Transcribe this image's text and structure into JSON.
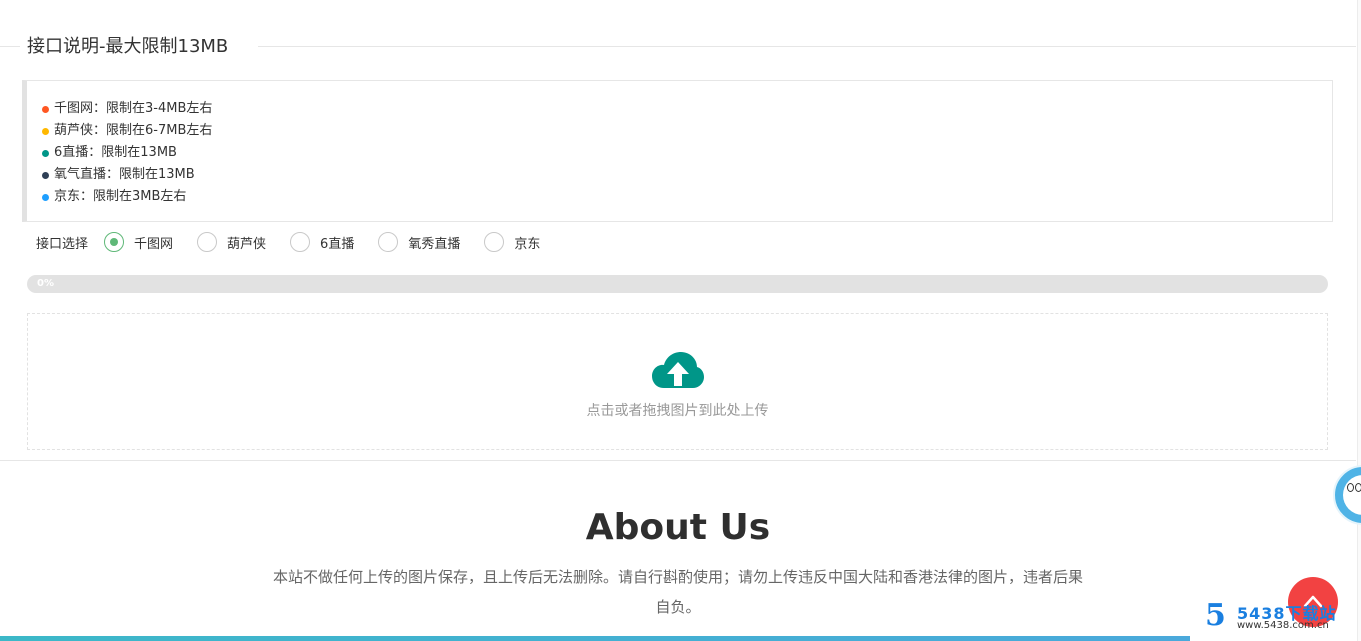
{
  "section": {
    "legend": "接口说明-最大限制13MB"
  },
  "notice": {
    "items": [
      {
        "label": "千图网：限制在3-4MB左右",
        "dot_color": "#ff5722"
      },
      {
        "label": "葫芦侠：限制在6-7MB左右",
        "dot_color": "#ffb800"
      },
      {
        "label": "6直播：限制在13MB",
        "dot_color": "#009688"
      },
      {
        "label": "氧气直播：限制在13MB",
        "dot_color": "#2f4056"
      },
      {
        "label": "京东：限制在3MB左右",
        "dot_color": "#1e9fff"
      }
    ]
  },
  "interface_select": {
    "label": "接口选择",
    "options": [
      "千图网",
      "葫芦侠",
      "6直播",
      "氧秀直播",
      "京东"
    ],
    "selected": "千图网"
  },
  "progress": {
    "value": 0,
    "text": "0%"
  },
  "upload": {
    "hint": "点击或者拖拽图片到此处上传",
    "icon": "cloud-upload-icon",
    "icon_color": "#009688"
  },
  "about": {
    "title": "About Us",
    "text": "本站不做任何上传的图片保存，且上传后无法删除。请自行斟酌使用；请勿上传违反中国大陆和香港法律的图片，违者后果自负。"
  },
  "back_to_top": {
    "icon": "chevron-up-icon",
    "color": "#f24242"
  },
  "watermark": {
    "logo": "5",
    "name": "5438下载站",
    "url": "www.5438.com.cn"
  },
  "colors": {
    "accent_green": "#5fb878",
    "bottom_bar": "#3cb8c8"
  }
}
